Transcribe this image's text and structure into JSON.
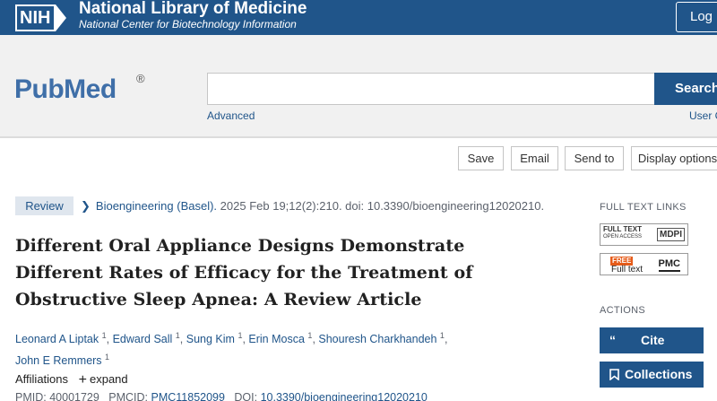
{
  "nih_banner": {
    "logo_text": "NIH",
    "title": "National Library of Medicine",
    "subtitle": "National Center for Biotechnology Information",
    "login_label": "Log i"
  },
  "search": {
    "logo_text": "PubMed",
    "logo_mark": "®",
    "input_value": "",
    "button_label": "Search",
    "advanced_label": "Advanced",
    "user_guide_label": "User G"
  },
  "toolbar": {
    "save_label": "Save",
    "email_label": "Email",
    "send_to_label": "Send to",
    "display_options_label": "Display options"
  },
  "article": {
    "type_badge": "Review",
    "journal": "Bioengineering (Basel).",
    "citation_rest": "2025 Feb 19;12(2):210. doi: 10.3390/bioengineering12020210.",
    "title": "Different Oral Appliance Designs Demonstrate Different Rates of Efficacy for the Treatment of Obstructive Sleep Apnea: A Review Article",
    "authors": [
      {
        "name": "Leonard A Liptak",
        "sup": "1"
      },
      {
        "name": "Edward Sall",
        "sup": "1"
      },
      {
        "name": "Sung Kim",
        "sup": "1"
      },
      {
        "name": "Erin Mosca",
        "sup": "1"
      },
      {
        "name": "Shouresh Charkhandeh",
        "sup": "1"
      },
      {
        "name": "John E Remmers",
        "sup": "1"
      }
    ],
    "affiliations_label": "Affiliations",
    "expand_label": "expand",
    "pmid_label": "PMID:",
    "pmid": "40001729",
    "pmcid_label": "PMCID:",
    "pmcid": "PMC11852099",
    "doi_label": "DOI:",
    "doi": "10.3390/bioengineering12020210"
  },
  "sidebar": {
    "full_text_links_label": "FULL TEXT LINKS",
    "mdpi_line1": "FULL TEXT",
    "mdpi_line2": "OPEN ACCESS",
    "mdpi_brand": "MDPI",
    "pmc_free": "FREE",
    "pmc_full": "Full text",
    "pmc_brand": "PMC",
    "actions_label": "ACTIONS",
    "cite_label": "Cite",
    "collections_label": "Collections"
  },
  "colors": {
    "nih_blue": "#20558a",
    "link_blue": "#20558a",
    "free_orange": "#e65c1a"
  }
}
